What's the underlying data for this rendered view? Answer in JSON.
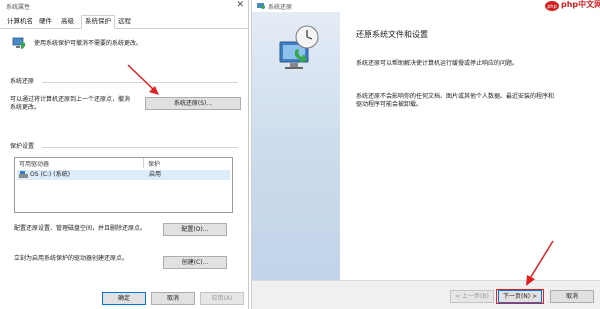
{
  "left_dialog": {
    "title": "系统属性",
    "close_glyph": "✕",
    "tabs": [
      "计算机名",
      "硬件",
      "高级",
      "系统保护",
      "远程"
    ],
    "active_tab_index": 3,
    "intro_text": "使用系统保护可撤消不需要的系统更改。",
    "restore_section": {
      "heading": "系统还原",
      "description_line1": "可以通过将计算机还原到上一个还原点，撤消",
      "description_line2": "系统更改。",
      "button": "系统还原(S)..."
    },
    "protection_section": {
      "heading": "保护设置",
      "columns": [
        "可用驱动器",
        "保护"
      ],
      "rows": [
        {
          "drive": "OS (C:) (系统)",
          "protection": "启用"
        }
      ]
    },
    "configure": {
      "text": "配置还原设置、管理磁盘空间，并且删除还原点。",
      "button": "配置(O)..."
    },
    "create": {
      "text": "立刻为启用系统保护的驱动器创建还原点。",
      "button": "创建(C)..."
    },
    "footer_buttons": {
      "ok": "确定",
      "cancel": "取消",
      "apply": "应用(A)"
    }
  },
  "right_dialog": {
    "title": "系统还原",
    "close_glyph": "✕",
    "heading": "还原系统文件和设置",
    "para1_line1": "系统还原可以帮助解决使计算机运行缓慢或停止响应的问题。",
    "para2_line1": "系统还原不会影响你的任何文档、图片或其他个人数据。最近安装的程序和",
    "para2_line2": "驱动程序可能会被卸载。",
    "buttons": {
      "back": "< 上一步(B)",
      "next": "下一页(N) >",
      "cancel": "取消"
    }
  },
  "watermark": {
    "text": "php中文网"
  },
  "colors": {
    "arrow": "#e02020",
    "accent": "#0078d7",
    "watermark": "#d11f1f"
  }
}
